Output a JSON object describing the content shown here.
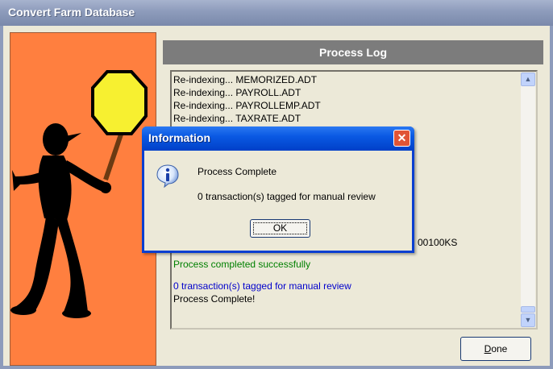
{
  "window": {
    "title": "Convert Farm Database"
  },
  "log": {
    "header": "Process Log",
    "lines_top": [
      "Re-indexing... MEMORIZED.ADT",
      "Re-indexing... PAYROLL.ADT",
      "Re-indexing... PAYROLLEMP.ADT",
      "Re-indexing... TAXRATE.ADT"
    ],
    "partial_text": "00100KS",
    "success": "Process completed successfully",
    "tagged": "0 transaction(s) tagged for manual review",
    "complete": "Process Complete!"
  },
  "buttons": {
    "done_prefix": "",
    "done_mnemonic": "D",
    "done_rest": "one"
  },
  "dialog": {
    "title": "Information",
    "message": "Process Complete",
    "detail": "0 transaction(s) tagged for manual review",
    "ok": "OK",
    "icon": "info-icon"
  },
  "colors": {
    "orange_panel": "#ff7f3f",
    "xp_blue": "#0a59e3",
    "success_green": "#008000",
    "tagged_blue": "#0000cc"
  }
}
